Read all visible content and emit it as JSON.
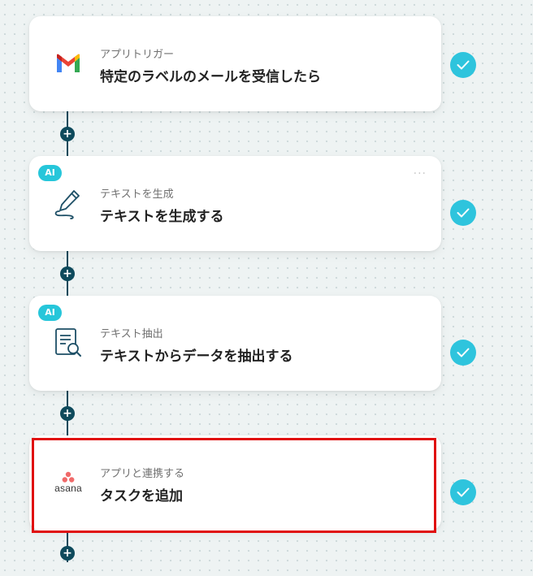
{
  "flow": {
    "steps": [
      {
        "id": "gmail-trigger",
        "subtitle": "アプリトリガー",
        "title": "特定のラベルのメールを受信したら",
        "icon": "gmail-icon",
        "ai": false,
        "status": "completed"
      },
      {
        "id": "generate-text",
        "subtitle": "テキストを生成",
        "title": "テキストを生成する",
        "icon": "pen-icon",
        "ai": true,
        "ai_label": "AI",
        "status": "completed"
      },
      {
        "id": "extract-text",
        "subtitle": "テキスト抽出",
        "title": "テキストからデータを抽出する",
        "icon": "document-search-icon",
        "ai": true,
        "ai_label": "AI",
        "status": "completed"
      },
      {
        "id": "asana-add-task",
        "subtitle": "アプリと連携する",
        "title": "タスクを追加",
        "icon": "asana-icon",
        "app_label": "asana",
        "ai": false,
        "status": "completed",
        "highlighted": true
      }
    ],
    "add_step_symbol": "+",
    "more_symbol": "···"
  },
  "colors": {
    "connector": "#0e4a5c",
    "check": "#2ec4dd",
    "ai_badge": "#26c6da",
    "highlight": "#e00d0d",
    "gmail_red": "#ea4335",
    "asana_coral": "#f06a6a"
  }
}
